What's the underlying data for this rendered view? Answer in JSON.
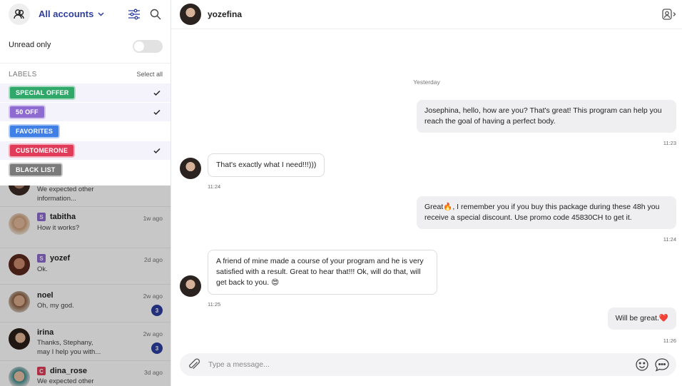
{
  "sidebar": {
    "accounts_label": "All accounts",
    "unread_label": "Unread only",
    "labels_title": "LABELS",
    "select_all": "Select all",
    "labels": [
      {
        "name": "SPECIAL OFFER",
        "color": "#2fa86a",
        "selected": true
      },
      {
        "name": "50 OFF",
        "color": "#8e6bd1",
        "selected": true
      },
      {
        "name": "FAVORITES",
        "color": "#3f7fe6",
        "selected": false
      },
      {
        "name": "CUSTOMERONE",
        "color": "#e03c5a",
        "selected": true
      },
      {
        "name": "BLACK LIST",
        "color": "#7a7a7a",
        "selected": false
      }
    ],
    "conversations": [
      {
        "name": "",
        "preview": "We expected other\ninformation...",
        "time": "",
        "badge": "",
        "count": ""
      },
      {
        "name": "tabitha",
        "preview": "How it works?",
        "time": "1w ago",
        "badge": "S",
        "badge_color": "#8e6bd1",
        "count": ""
      },
      {
        "name": "yozef",
        "preview": "Ok.",
        "time": "2d ago",
        "badge": "S",
        "badge_color": "#8e6bd1",
        "count": ""
      },
      {
        "name": "noel",
        "preview": "Oh, my god.",
        "time": "2w ago",
        "badge": "",
        "count": "3"
      },
      {
        "name": "irina",
        "preview": "Thanks, Stephany,\nmay I help you with...",
        "time": "2w ago",
        "badge": "",
        "count": "3"
      },
      {
        "name": "dina_rose",
        "preview": "We expected other",
        "time": "3d ago",
        "badge": "C",
        "badge_color": "#e03c5a",
        "count": ""
      }
    ]
  },
  "chat": {
    "contact_name": "yozefina",
    "day_separator": "Yesterday",
    "messages": [
      {
        "dir": "out",
        "text": "Josephina, hello, how are you? That's great! This program can help you reach the goal of having a perfect body.",
        "time": "11:23"
      },
      {
        "dir": "in",
        "text": "That's exactly what I need!!!)))",
        "time": "11:24"
      },
      {
        "dir": "out",
        "text_before": "Great",
        "emoji": "🔥",
        "text_after": ", I remember you if you buy this package during these 48h you receive a special discount. Use promo code 45830CH to get it.",
        "time": "11:24"
      },
      {
        "dir": "in",
        "text": "A friend of mine made a course of your program and he is very satisfied with a result. Great to hear that!!! Ok, will do that, will get back to you.",
        "emoji": "😍",
        "time": "11:25"
      },
      {
        "dir": "out",
        "text": "Will be great.",
        "emoji": "❤️",
        "time": "11:26"
      }
    ],
    "composer_placeholder": "Type a message..."
  },
  "colors": {
    "accent": "#2d3e9e",
    "incoming_bubble_border": "#dcdcdc",
    "outgoing_bubble": "#efeff1"
  }
}
